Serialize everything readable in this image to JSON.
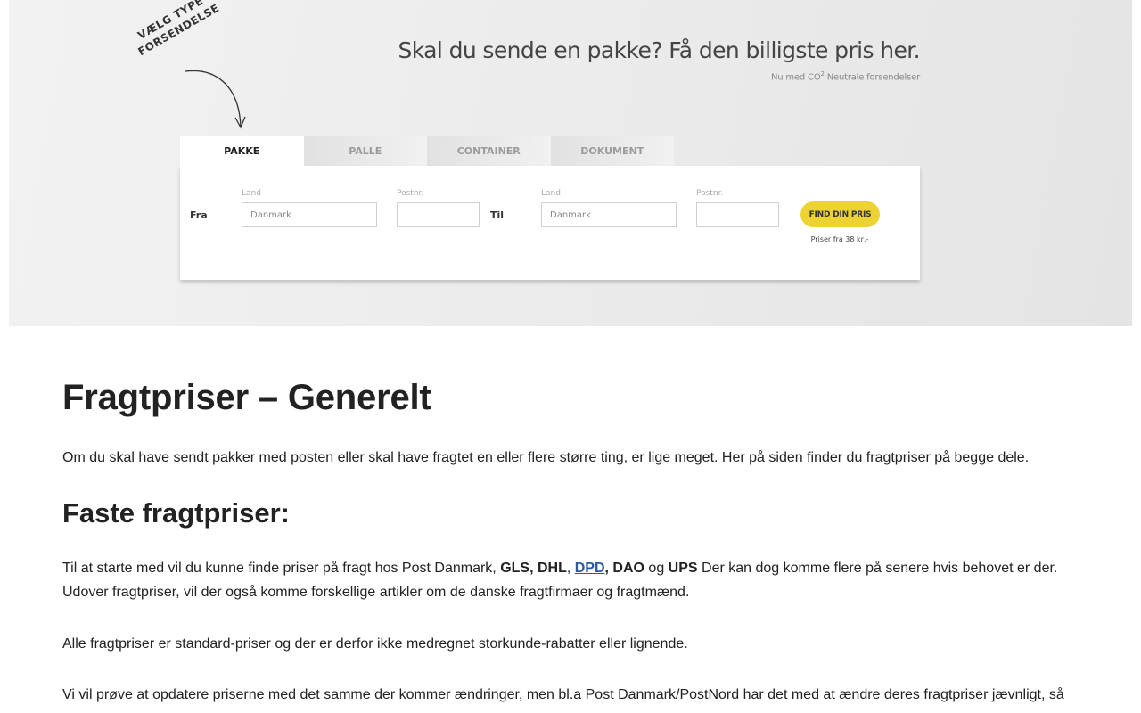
{
  "hero": {
    "callout_line1": "VÆLG TYPE",
    "callout_line2": "FORSENDELSE",
    "title": "Skal du sende en pakke? Få den billigste pris her.",
    "subtitle_pre": "Nu med CO",
    "subtitle_sup": "2",
    "subtitle_post": " Neutrale forsendelser",
    "tabs": [
      {
        "label": "PAKKE",
        "active": true
      },
      {
        "label": "PALLE",
        "active": false
      },
      {
        "label": "CONTAINER",
        "active": false
      },
      {
        "label": "DOKUMENT",
        "active": false
      }
    ],
    "form": {
      "from_label": "Fra",
      "to_label": "Til",
      "country_label": "Land",
      "postal_label": "Postnr.",
      "from_country_placeholder": "Danmark",
      "to_country_placeholder": "Danmark",
      "from_postal_value": "",
      "to_postal_value": "",
      "button_label": "FIND DIN PRIS",
      "price_note": "Priser fra 38 kr,-"
    },
    "colors": {
      "button": "#ecd233"
    }
  },
  "article": {
    "title": "Fragtpriser – Generelt",
    "intro": "Om du skal have sendt pakker med posten eller skal have fragtet en eller flere større ting, er lige meget. Her på siden finder du fragtpriser på begge dele.",
    "section_title": "Faste fragtpriser:",
    "p1_start": "Til at starte med vil du kunne finde priser på fragt hos Post Danmark, ",
    "p1_gls_dhl": "GLS, DHL",
    "p1_comma": ", ",
    "p1_dpd": "DPD",
    "p1_dao": ", DAO",
    "p1_og": " og ",
    "p1_ups": "UPS",
    "p1_end": " Der kan dog komme flere på senere hvis behovet er der. Udover fragtpriser, vil der også komme forskellige artikler om de danske fragtfirmaer og fragtmænd.",
    "p2": "Alle fragtpriser er standard-priser og der er derfor ikke medregnet storkunde-rabatter eller lignende.",
    "p3": "Vi vil prøve at opdatere priserne med det samme der kommer ændringer, men bl.a Post Danmark/PostNord har det med at ændre deres fragtpriser jævnligt, så"
  }
}
